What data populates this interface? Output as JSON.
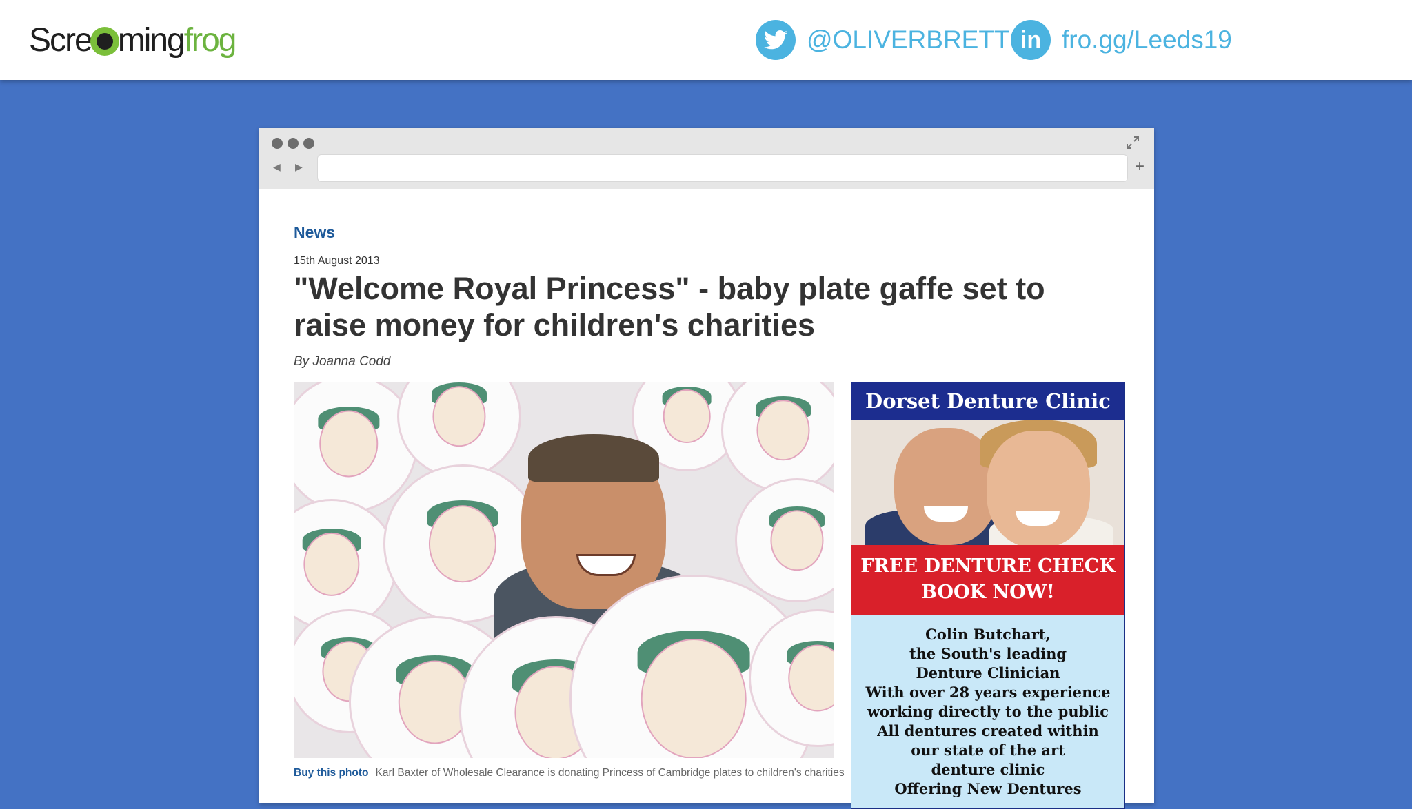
{
  "header": {
    "logo": {
      "part1": "Scre",
      "part2": "ming",
      "part3": "frog"
    },
    "twitter_handle": "@OLIVERBRETT",
    "linkedin_link": "fro.gg/Leeds19",
    "accent_color": "#4bb3e0"
  },
  "slide": {
    "background_color": "#4472c4"
  },
  "browser": {
    "url": "",
    "new_tab_symbol": "+"
  },
  "article": {
    "section": "News",
    "date": "15th August 2013",
    "headline": "\"Welcome Royal Princess\" - baby plate gaffe set to raise money for children's charities",
    "byline": "By Joanna Codd",
    "photo_caption_link": "Buy this photo",
    "photo_caption": "Karl Baxter of Wholesale Clearance is donating Princess of Cambridge plates to children's charities"
  },
  "advert": {
    "title": "Dorset Denture Clinic",
    "cta_line1": "FREE DENTURE CHECK",
    "cta_line2": "BOOK NOW!",
    "body_lines": [
      "Colin Butchart,",
      "the South's leading",
      "Denture Clinician",
      "With over 28 years experience",
      "working directly to the public",
      "All dentures created within",
      "our state of the art",
      "denture clinic",
      "Offering New Dentures"
    ]
  }
}
